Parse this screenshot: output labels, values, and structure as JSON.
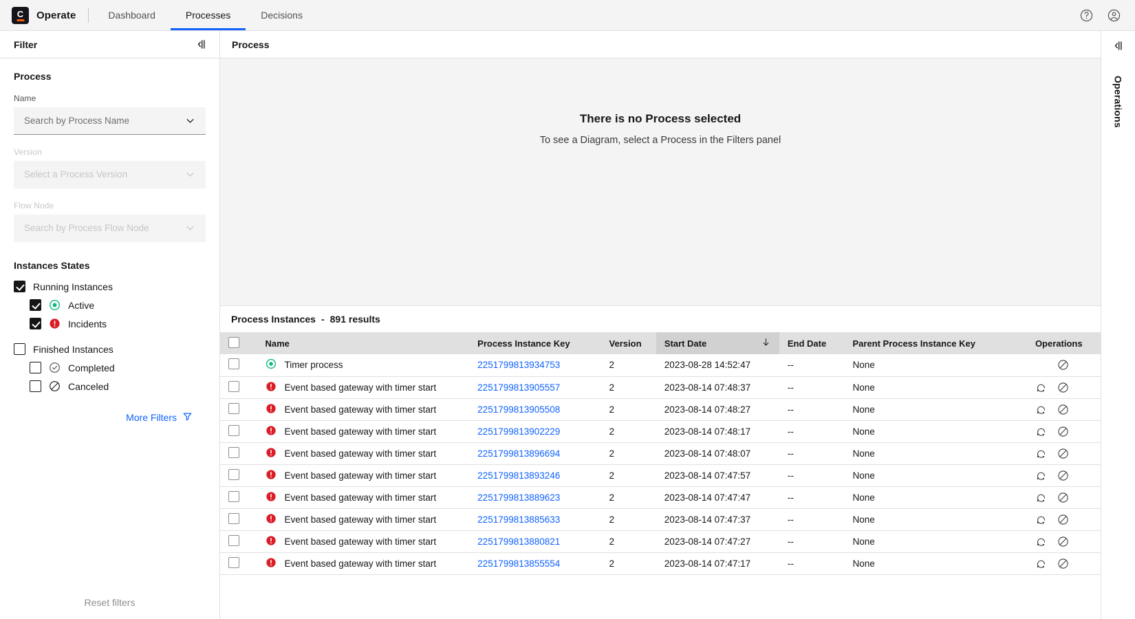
{
  "app": {
    "brand_name": "Operate",
    "logo_letter": "C",
    "accent_blue": "#0f62fe",
    "accent_orange": "#fc5d0d"
  },
  "topnav": {
    "items": [
      {
        "label": "Dashboard",
        "active": false
      },
      {
        "label": "Processes",
        "active": true
      },
      {
        "label": "Decisions",
        "active": false
      }
    ],
    "help_icon": "help-icon",
    "user_icon": "user-avatar-icon"
  },
  "filter_panel": {
    "title": "Filter",
    "collapse_icon": "collapse-panel-icon",
    "process_section_title": "Process",
    "name_label": "Name",
    "name_placeholder": "Search by Process Name",
    "version_label": "Version",
    "version_placeholder": "Select a Process Version",
    "flownode_label": "Flow Node",
    "flownode_placeholder": "Search by Process Flow Node",
    "states_title": "Instances States",
    "states": {
      "running_label": "Running Instances",
      "running_checked": true,
      "active_label": "Active",
      "active_checked": true,
      "incidents_label": "Incidents",
      "incidents_checked": true,
      "finished_label": "Finished Instances",
      "finished_checked": false,
      "completed_label": "Completed",
      "completed_checked": false,
      "canceled_label": "Canceled",
      "canceled_checked": false
    },
    "more_filters_label": "More Filters",
    "more_filters_icon": "filter-funnel-icon",
    "reset_filters_label": "Reset filters"
  },
  "process_panel": {
    "title": "Process",
    "empty_title": "There is no Process selected",
    "empty_subtitle": "To see a Diagram, select a Process in the Filters panel"
  },
  "instances": {
    "title": "Process Instances",
    "separator": "-",
    "results_text": "891 results",
    "columns": {
      "name": "Name",
      "process_instance_key": "Process Instance Key",
      "version": "Version",
      "start_date": "Start Date",
      "end_date": "End Date",
      "parent_process_instance_key": "Parent Process Instance Key",
      "operations": "Operations"
    },
    "sort": {
      "column": "Start Date",
      "direction": "desc",
      "icon": "sort-arrow-down-icon"
    },
    "rows": [
      {
        "status": "active",
        "name": "Timer process",
        "key": "2251799813934753",
        "version": "2",
        "start": "2023-08-28 14:52:47",
        "end": "--",
        "parent": "None",
        "ops": [
          "cancel"
        ]
      },
      {
        "status": "incident",
        "name": "Event based gateway with timer start",
        "key": "2251799813905557",
        "version": "2",
        "start": "2023-08-14 07:48:37",
        "end": "--",
        "parent": "None",
        "ops": [
          "retry",
          "cancel"
        ]
      },
      {
        "status": "incident",
        "name": "Event based gateway with timer start",
        "key": "2251799813905508",
        "version": "2",
        "start": "2023-08-14 07:48:27",
        "end": "--",
        "parent": "None",
        "ops": [
          "retry",
          "cancel"
        ]
      },
      {
        "status": "incident",
        "name": "Event based gateway with timer start",
        "key": "2251799813902229",
        "version": "2",
        "start": "2023-08-14 07:48:17",
        "end": "--",
        "parent": "None",
        "ops": [
          "retry",
          "cancel"
        ]
      },
      {
        "status": "incident",
        "name": "Event based gateway with timer start",
        "key": "2251799813896694",
        "version": "2",
        "start": "2023-08-14 07:48:07",
        "end": "--",
        "parent": "None",
        "ops": [
          "retry",
          "cancel"
        ]
      },
      {
        "status": "incident",
        "name": "Event based gateway with timer start",
        "key": "2251799813893246",
        "version": "2",
        "start": "2023-08-14 07:47:57",
        "end": "--",
        "parent": "None",
        "ops": [
          "retry",
          "cancel"
        ]
      },
      {
        "status": "incident",
        "name": "Event based gateway with timer start",
        "key": "2251799813889623",
        "version": "2",
        "start": "2023-08-14 07:47:47",
        "end": "--",
        "parent": "None",
        "ops": [
          "retry",
          "cancel"
        ]
      },
      {
        "status": "incident",
        "name": "Event based gateway with timer start",
        "key": "2251799813885633",
        "version": "2",
        "start": "2023-08-14 07:47:37",
        "end": "--",
        "parent": "None",
        "ops": [
          "retry",
          "cancel"
        ]
      },
      {
        "status": "incident",
        "name": "Event based gateway with timer start",
        "key": "2251799813880821",
        "version": "2",
        "start": "2023-08-14 07:47:27",
        "end": "--",
        "parent": "None",
        "ops": [
          "retry",
          "cancel"
        ]
      },
      {
        "status": "incident",
        "name": "Event based gateway with timer start",
        "key": "2251799813855554",
        "version": "2",
        "start": "2023-08-14 07:47:17",
        "end": "--",
        "parent": "None",
        "ops": [
          "retry",
          "cancel"
        ]
      }
    ]
  },
  "operations_rail": {
    "label": "Operations",
    "collapse_icon": "expand-panel-icon"
  },
  "colors": {
    "active_green": "#10b981",
    "incident_red": "#da1e28",
    "link_blue": "#0f62fe"
  }
}
